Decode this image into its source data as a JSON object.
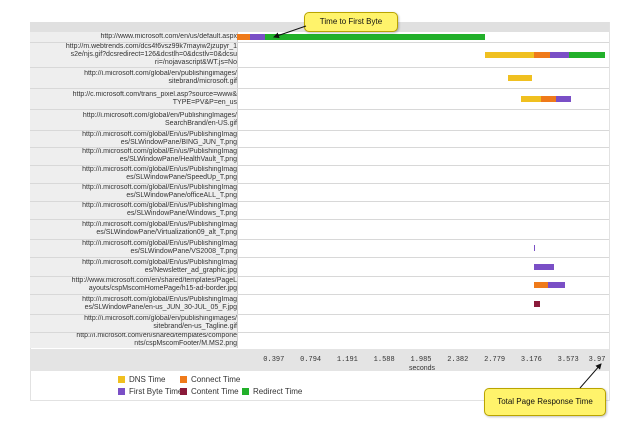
{
  "colors": {
    "dns": "#f0c020",
    "connect": "#ef7a1a",
    "first_byte": "#7a4fc6",
    "content": "#8a1a3a",
    "redirect": "#22b02a"
  },
  "rows": [
    {
      "lines": [
        "http://www.microsoft.com/en/us/default.aspx"
      ]
    },
    {
      "lines": [
        "http://m.webtrends.com/dcs4f6vsz99k7mayiw2jzupyr_1",
        "s2e/njs.gif?dcsredirect=126&dcstlh=0&dcstlv=0&dcsu",
        "ri=/nojavascript&WT.js=No"
      ]
    },
    {
      "lines": [
        "http://i.microsoft.com/global/en/publishingimages/",
        "sitebrand/microsoft.gif"
      ]
    },
    {
      "lines": [
        "http://c.microsoft.com/trans_pixel.asp?source=www&",
        "TYPE=PV&P=en_us"
      ]
    },
    {
      "lines": [
        "http://i.microsoft.com/global/en/PublishingImages/",
        "SearchBrand/en-US.gif"
      ]
    },
    {
      "lines": [
        "http://i.microsoft.com/global/En/us/PublishingImag",
        "es/SLWindowPane/BING_JUN_T.png"
      ]
    },
    {
      "lines": [
        "http://i.microsoft.com/global/En/us/PublishingImag",
        "es/SLWindowPane/HealthVault_T.png"
      ]
    },
    {
      "lines": [
        "http://i.microsoft.com/global/En/us/PublishingImag",
        "es/SLWindowPane/SpeedUp_T.png"
      ]
    },
    {
      "lines": [
        "http://i.microsoft.com/global/En/us/PublishingImag",
        "es/SLWindowPane/officeALL_T.png"
      ]
    },
    {
      "lines": [
        "http://i.microsoft.com/global/En/us/PublishingImag",
        "es/SLWindowPane/Windows_T.png"
      ]
    },
    {
      "lines": [
        "http://i.microsoft.com/global/En/us/PublishingImag",
        "es/SLWindowPane/Virtualization09_alt_T.png"
      ]
    },
    {
      "lines": [
        "http://i.microsoft.com/global/En/us/PublishingImag",
        "es/SLWindowPane/VS2008_T.png"
      ]
    },
    {
      "lines": [
        "http://i.microsoft.com/global/En/us/PublishingImag",
        "es/Newsletter_ad_graphic.jpg"
      ]
    },
    {
      "lines": [
        "http://www.microsoft.com/en/shared/templates/PageL",
        "ayouts/cspMscomHomePage/h15-ad-border.jpg"
      ]
    },
    {
      "lines": [
        "http://i.microsoft.com/global/En/us/PublishingImag",
        "es/SLWindowPane/en-us_JUN_30-JUL_05_F.jpg"
      ]
    },
    {
      "lines": [
        "http://i.microsoft.com/global/en/publishingimages/",
        "sitebrand/en-us_Tagline.gif"
      ]
    },
    {
      "lines": [
        "http://i.microsoft.com/en/shared/templates/compone",
        "nts/cspMscomFooter/M.MS2.png"
      ]
    }
  ],
  "chart_data": {
    "type": "bar",
    "subtype": "waterfall",
    "xlabel": "seconds",
    "xlim": [
      0,
      3.97
    ],
    "ticks": [
      "0.397",
      "0.794",
      "1.191",
      "1.588",
      "1.985",
      "2.382",
      "2.779",
      "3.176",
      "3.573",
      "3.97"
    ],
    "tick_values": [
      0.397,
      0.794,
      1.191,
      1.588,
      1.985,
      2.382,
      2.779,
      3.176,
      3.573,
      3.97
    ],
    "series": [
      {
        "name": "DNS Time",
        "color": "#f0c020"
      },
      {
        "name": "Connect Time",
        "color": "#ef7a1a"
      },
      {
        "name": "First Byte Time",
        "color": "#7a4fc6"
      },
      {
        "name": "Content Time",
        "color": "#8a1a3a"
      },
      {
        "name": "Redirect Time",
        "color": "#22b02a"
      }
    ],
    "requests": [
      {
        "segments": [
          {
            "phase": "connect",
            "start": 0.0,
            "end": 0.14
          },
          {
            "phase": "first_byte",
            "start": 0.14,
            "end": 0.3
          },
          {
            "phase": "redirect",
            "start": 0.3,
            "end": 2.68
          }
        ]
      },
      {
        "segments": [
          {
            "phase": "dns",
            "start": 2.68,
            "end": 3.2
          },
          {
            "phase": "connect",
            "start": 3.2,
            "end": 3.38
          },
          {
            "phase": "first_byte",
            "start": 3.38,
            "end": 3.58
          },
          {
            "phase": "redirect",
            "start": 3.58,
            "end": 3.97
          }
        ]
      },
      {
        "segments": [
          {
            "phase": "dns",
            "start": 2.92,
            "end": 3.18
          }
        ]
      },
      {
        "segments": [
          {
            "phase": "dns",
            "start": 3.06,
            "end": 3.28
          },
          {
            "phase": "connect",
            "start": 3.28,
            "end": 3.44
          },
          {
            "phase": "first_byte",
            "start": 3.44,
            "end": 3.6
          }
        ]
      },
      {
        "segments": []
      },
      {
        "segments": []
      },
      {
        "segments": []
      },
      {
        "segments": []
      },
      {
        "segments": []
      },
      {
        "segments": []
      },
      {
        "segments": []
      },
      {
        "segments": [
          {
            "phase": "first_byte",
            "start": 3.2,
            "end": 3.215
          }
        ]
      },
      {
        "segments": [
          {
            "phase": "first_byte",
            "start": 3.2,
            "end": 3.42
          }
        ]
      },
      {
        "segments": [
          {
            "phase": "connect",
            "start": 3.2,
            "end": 3.36
          },
          {
            "phase": "first_byte",
            "start": 3.36,
            "end": 3.54
          }
        ]
      },
      {
        "segments": [
          {
            "phase": "content",
            "start": 3.2,
            "end": 3.27
          }
        ]
      },
      {
        "segments": []
      },
      {
        "segments": []
      }
    ]
  },
  "legend": {
    "dns": "DNS Time",
    "connect": "Connect Time",
    "first_byte": "First Byte Time",
    "content": "Content Time",
    "redirect": "Redirect Time"
  },
  "callouts": {
    "first_byte": "Time to First Byte",
    "total": "Total Page Response Time"
  }
}
